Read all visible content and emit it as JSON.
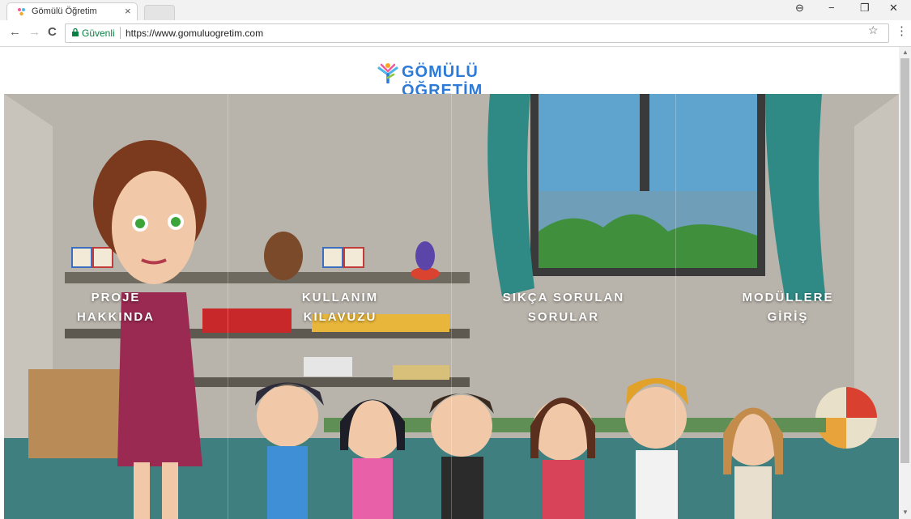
{
  "browser": {
    "tab_title": "Gömülü Öğretim",
    "tab_close": "×",
    "secure_label": "Güvenli",
    "url": "https://www.gomuluogretim.com",
    "back": "←",
    "forward": "→",
    "reload": "C",
    "star": "☆",
    "menu": "⋮",
    "profile": "⊖",
    "minimize": "−",
    "restore": "❐",
    "close": "✕"
  },
  "page": {
    "logo_text": "GÖMÜLÜ ÖĞRETİM",
    "logo_colors": [
      "#f15a9c",
      "#f7a823",
      "#4db6e8",
      "#2e7bd7"
    ],
    "panels": [
      {
        "label": "PROJE\nHAKKINDA"
      },
      {
        "label": "KULLANIM\nKILAVUZU"
      },
      {
        "label": "SIKÇA SORULAN\nSORULAR"
      },
      {
        "label": "MODÜLLERE\nGİRİŞ"
      }
    ]
  }
}
